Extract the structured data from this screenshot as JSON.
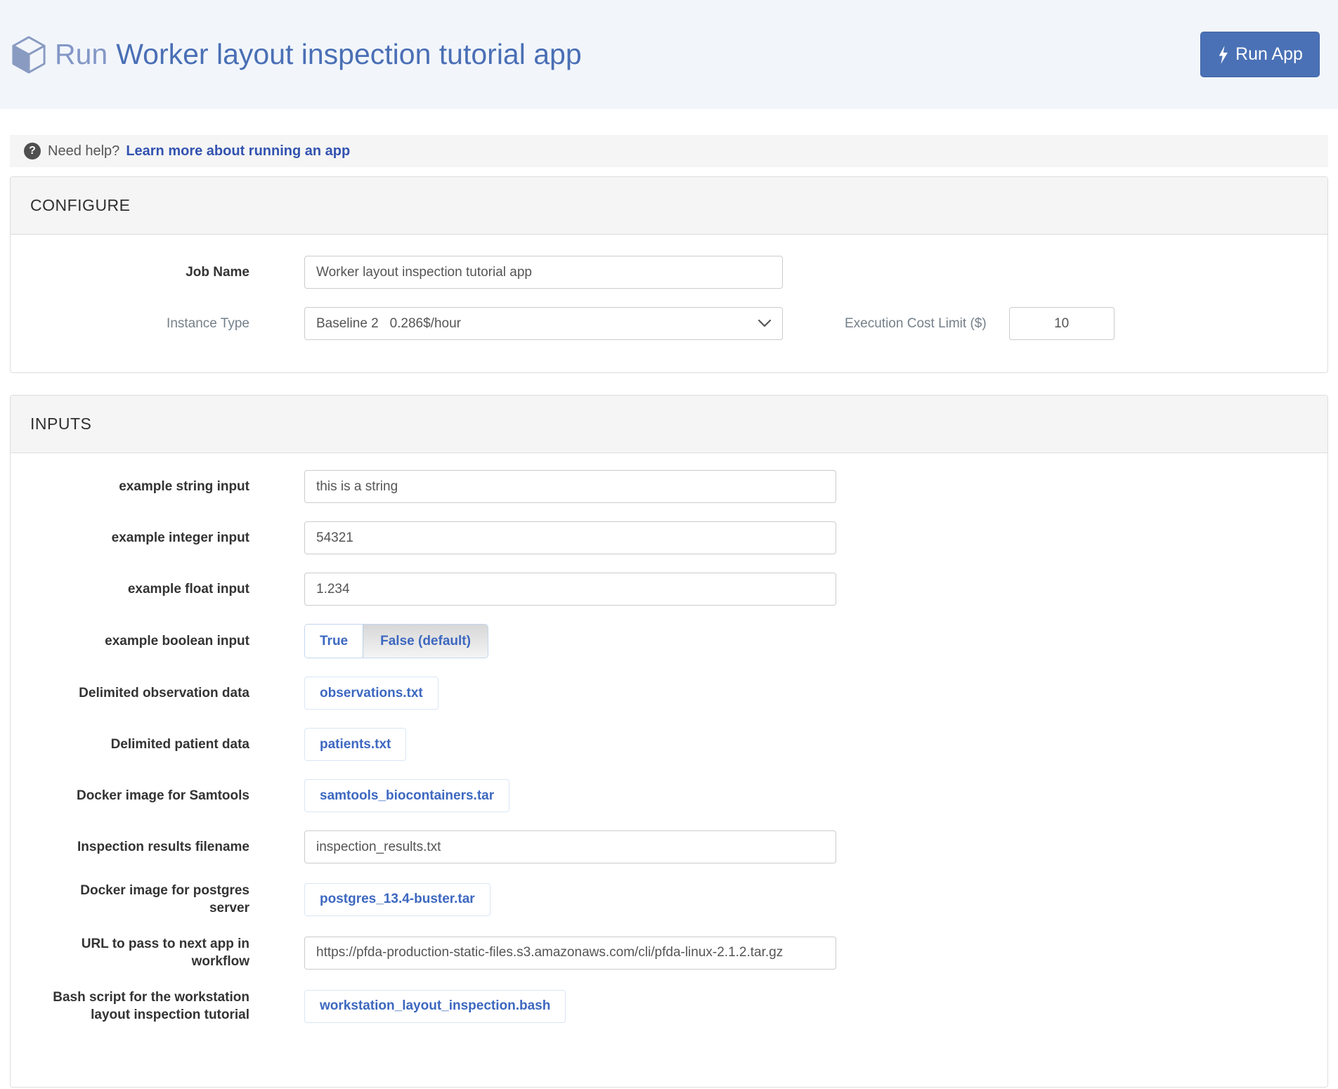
{
  "colors": {
    "header_bg": "#f2f6fb",
    "brand_blue": "#4a6fb5",
    "brand_blue_light": "#8397c6",
    "run_button_bg": "#4a71b6",
    "link_blue": "#3353b0",
    "file_link_blue": "#3d68c0",
    "panel_header_bg": "#f5f5f5"
  },
  "header": {
    "title_prefix": "Run",
    "title": "Worker layout inspection tutorial app",
    "run_button_label": "Run App"
  },
  "help": {
    "text": "Need help?",
    "link_label": "Learn more about running an app"
  },
  "configure": {
    "section_title": "CONFIGURE",
    "job_name": {
      "label": "Job Name",
      "value": "Worker layout inspection tutorial app"
    },
    "instance_type": {
      "label": "Instance Type",
      "value": "Baseline 2   0.286$/hour"
    },
    "cost_limit": {
      "label": "Execution Cost Limit ($)",
      "value": "10"
    }
  },
  "inputs": {
    "section_title": "INPUTS",
    "fields": [
      {
        "type": "text",
        "label": "example string input",
        "value": "this is a string"
      },
      {
        "type": "text",
        "label": "example integer input",
        "value": "54321"
      },
      {
        "type": "text",
        "label": "example float input",
        "value": "1.234"
      },
      {
        "type": "boolean",
        "label": "example boolean input",
        "options": [
          "True",
          "False (default)"
        ],
        "selected": "False (default)"
      },
      {
        "type": "file",
        "label": "Delimited observation data",
        "value": "observations.txt"
      },
      {
        "type": "file",
        "label": "Delimited patient data",
        "value": "patients.txt"
      },
      {
        "type": "file",
        "label": "Docker image for Samtools",
        "value": "samtools_biocontainers.tar"
      },
      {
        "type": "text",
        "label": "Inspection results filename",
        "value": "inspection_results.txt"
      },
      {
        "type": "file",
        "label": "Docker image for postgres server",
        "value": "postgres_13.4-buster.tar"
      },
      {
        "type": "text",
        "label": "URL to pass to next app in workflow",
        "value": "https://pfda-production-static-files.s3.amazonaws.com/cli/pfda-linux-2.1.2.tar.gz"
      },
      {
        "type": "file",
        "label": "Bash script for the workstation layout inspection tutorial",
        "value": "workstation_layout_inspection.bash"
      }
    ]
  }
}
